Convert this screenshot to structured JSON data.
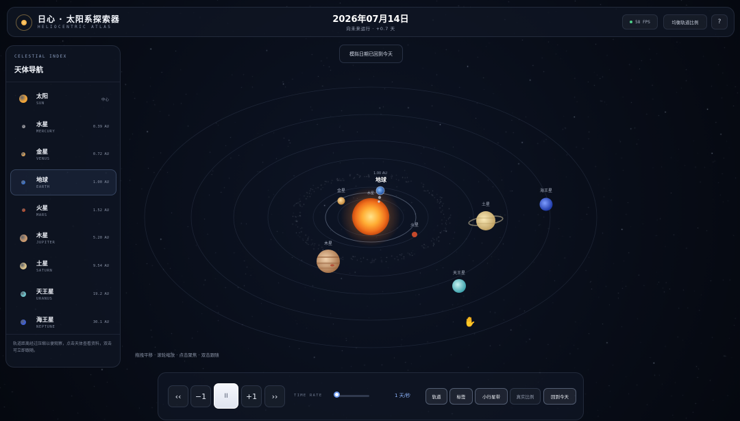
{
  "app": {
    "title": "日心 · 太阳系探索器",
    "subtitle": "HELIOCENTRIC ATLAS"
  },
  "header": {
    "date": "2026年07月14日",
    "date_sub": "向未来运行 · +0.7 天",
    "fps_label": "58 FPS",
    "scale_button": "均衡轨道比例",
    "help_button": "?"
  },
  "reset_button": "模拟日期已回到今天",
  "sidebar": {
    "kicker": "CELESTIAL INDEX",
    "title": "天体导航",
    "hint": "轨道距离经过压缩以便观察，点击天体查看资料，双击可立即跟随。",
    "items": [
      {
        "name": "太阳",
        "en": "SUN",
        "dist": "中心",
        "color": "#f0a53a",
        "size": 12,
        "active": false
      },
      {
        "name": "水星",
        "en": "MERCURY",
        "dist": "0.39 AU",
        "color": "#9a9aa0",
        "size": 5,
        "active": false
      },
      {
        "name": "金星",
        "en": "VENUS",
        "dist": "0.72 AU",
        "color": "#d6a25a",
        "size": 6,
        "active": false
      },
      {
        "name": "地球",
        "en": "EARTH",
        "dist": "1.00 AU",
        "color": "#3d73c8",
        "size": 6,
        "active": true
      },
      {
        "name": "火星",
        "en": "MARS",
        "dist": "1.52 AU",
        "color": "#c2502e",
        "size": 5,
        "active": false
      },
      {
        "name": "木星",
        "en": "JUPITER",
        "dist": "5.20 AU",
        "color": "#c99a70",
        "size": 11,
        "active": false
      },
      {
        "name": "土星",
        "en": "SATURN",
        "dist": "9.54 AU",
        "color": "#d7c08a",
        "size": 10,
        "active": false
      },
      {
        "name": "天王星",
        "en": "URANUS",
        "dist": "19.2 AU",
        "color": "#6fc5cc",
        "size": 8,
        "active": false
      },
      {
        "name": "海王星",
        "en": "NEPTUNE",
        "dist": "30.1 AU",
        "color": "#3f5fd0",
        "size": 8,
        "active": false
      }
    ]
  },
  "scene": {
    "earth_label": "地球",
    "earth_dist": "1.00 AU",
    "labels": {
      "venus": "金星",
      "mercury": "水星",
      "mars": "火星",
      "jupiter": "木星",
      "saturn": "土星",
      "uranus": "天王星",
      "neptune": "海王星"
    },
    "hint": "拖拽平移 · 滚轮缩放 · 点击聚焦 · 双击跟随"
  },
  "controls": {
    "rewind_fast": "‹‹",
    "minus_one": "−1",
    "pause": "II",
    "plus_one": "+1",
    "forward_fast": "››",
    "time_rate_label": "TIME RATE",
    "time_rate_value": "1 天/秒",
    "time_rate_fraction": 0.04,
    "toggles": [
      "轨道",
      "标签",
      "小行星带",
      "真实比例",
      "回到今天"
    ]
  }
}
